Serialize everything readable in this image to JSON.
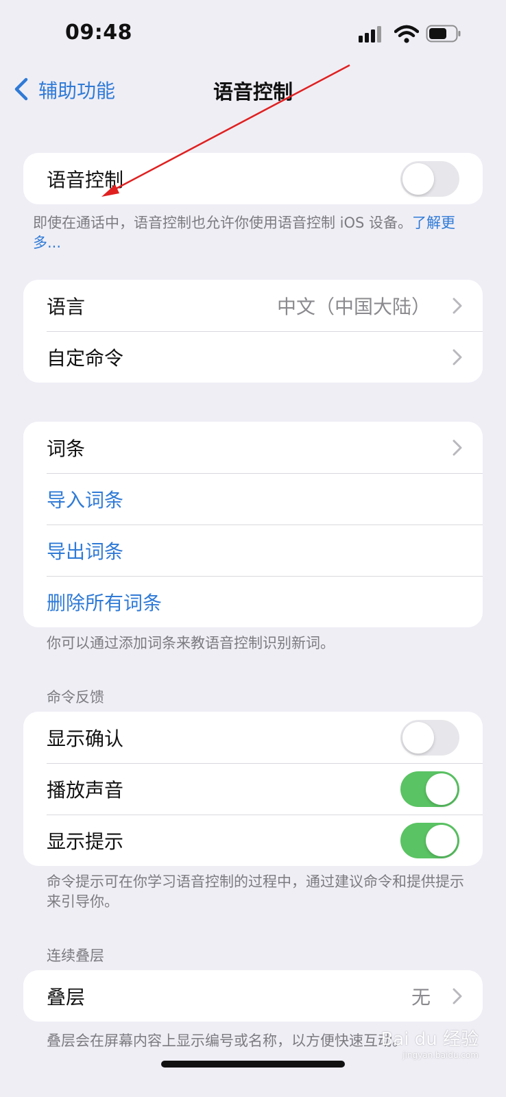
{
  "status_bar": {
    "time": "09:48"
  },
  "nav": {
    "back_label": "辅助功能",
    "title": "语音控制"
  },
  "voice_control": {
    "label": "语音控制",
    "toggle_on": false,
    "footer_text": "即使在通话中，语音控制也允许你使用语音控制 iOS 设备。",
    "footer_link": "了解更多..."
  },
  "language_section": {
    "language_label": "语言",
    "language_value": "中文（中国大陆）",
    "custom_commands_label": "自定命令"
  },
  "vocabulary_section": {
    "vocabulary_label": "词条",
    "import_label": "导入词条",
    "export_label": "导出词条",
    "delete_all_label": "删除所有词条",
    "footer_text": "你可以通过添加词条来教语音控制识别新词。"
  },
  "command_feedback": {
    "header": "命令反馈",
    "show_confirmation": {
      "label": "显示确认",
      "on": false
    },
    "play_sound": {
      "label": "播放声音",
      "on": true
    },
    "show_hints": {
      "label": "显示提示",
      "on": true
    },
    "footer_text": "命令提示可在你学习语音控制的过程中，通过建议命令和提供提示来引导你。"
  },
  "overlay_section": {
    "header": "连续叠层",
    "overlay_label": "叠层",
    "overlay_value": "无",
    "footer_text": "叠层会在屏幕内容上显示编号或名称，以方便快速互动。"
  },
  "watermark": {
    "brand": "Bai du 经验",
    "sub": "jingyan.baidu.com"
  },
  "colors": {
    "accent": "#2f7ad6",
    "toggle_on": "#5ac363",
    "background": "#efeef5",
    "annotation_arrow": "#e02020"
  }
}
